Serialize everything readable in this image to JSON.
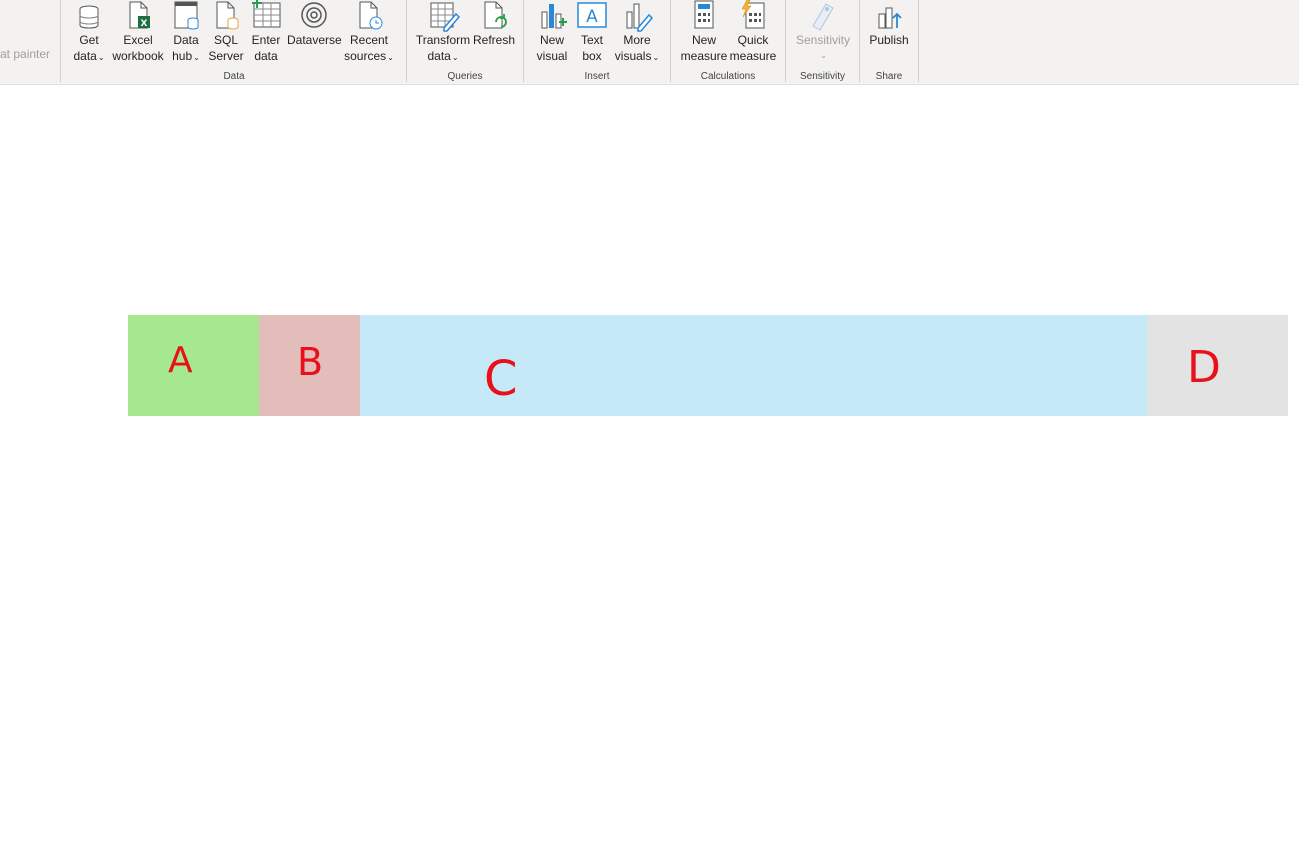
{
  "ribbon": {
    "format_painter": "at painter",
    "groups": {
      "data": "Data",
      "queries": "Queries",
      "insert": "Insert",
      "calculations": "Calculations",
      "sensitivity": "Sensitivity",
      "share": "Share"
    },
    "buttons": {
      "get_data": {
        "line1": "Get",
        "line2": "data"
      },
      "excel": {
        "line1": "Excel",
        "line2": "workbook"
      },
      "data_hub": {
        "line1": "Data",
        "line2": "hub"
      },
      "sql": {
        "line1": "SQL",
        "line2": "Server"
      },
      "enter_data": {
        "line1": "Enter",
        "line2": "data"
      },
      "dataverse": {
        "line1": "Dataverse"
      },
      "recent": {
        "line1": "Recent",
        "line2": "sources"
      },
      "transform": {
        "line1": "Transform",
        "line2": "data"
      },
      "refresh": {
        "line1": "Refresh"
      },
      "new_visual": {
        "line1": "New",
        "line2": "visual"
      },
      "text_box": {
        "line1": "Text",
        "line2": "box"
      },
      "more_visuals": {
        "line1": "More",
        "line2": "visuals"
      },
      "new_measure": {
        "line1": "New",
        "line2": "measure"
      },
      "quick_measure": {
        "line1": "Quick",
        "line2": "measure"
      },
      "sensitivity": {
        "line1": "Sensitivity"
      },
      "publish": {
        "line1": "Publish"
      }
    }
  },
  "canvas": {
    "blocks": [
      {
        "label": "A",
        "color": "#a6e88f"
      },
      {
        "label": "B",
        "color": "#e2bdb9"
      },
      {
        "label": "C",
        "color": "#c6e9f7"
      },
      {
        "label": "D",
        "color": "#e3e3e3"
      }
    ],
    "annotation_color": "#e8101a"
  }
}
